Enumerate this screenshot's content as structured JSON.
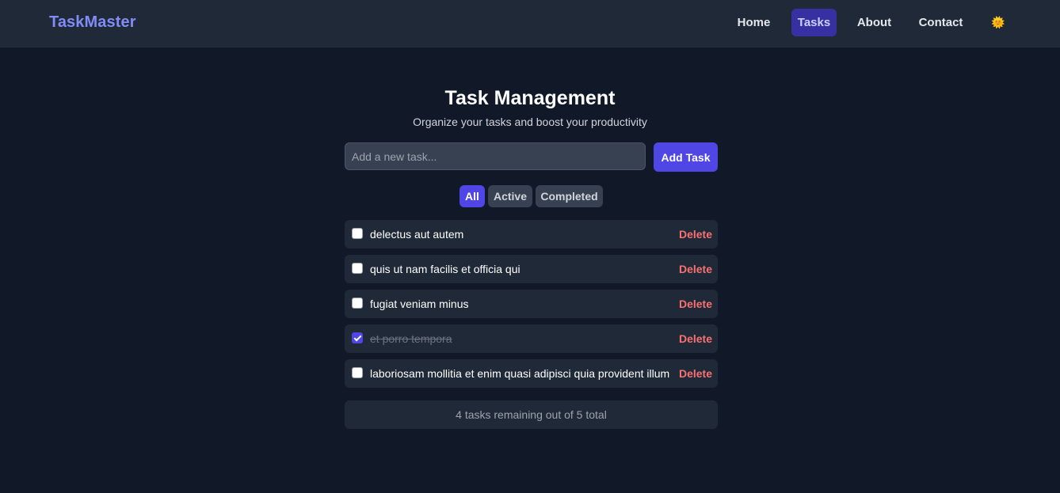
{
  "app": {
    "brand": "TaskMaster"
  },
  "nav": {
    "items": [
      {
        "label": "Home",
        "active": false
      },
      {
        "label": "Tasks",
        "active": true
      },
      {
        "label": "About",
        "active": false
      },
      {
        "label": "Contact",
        "active": false
      }
    ],
    "theme_icon": "sun-icon",
    "theme_glyph": "🌞"
  },
  "header": {
    "title": "Task Management",
    "subtitle": "Organize your tasks and boost your productivity"
  },
  "new_task": {
    "placeholder": "Add a new task...",
    "value": "",
    "button_label": "Add Task"
  },
  "filters": {
    "items": [
      {
        "label": "All",
        "active": true
      },
      {
        "label": "Active",
        "active": false
      },
      {
        "label": "Completed",
        "active": false
      }
    ]
  },
  "tasks": [
    {
      "text": "delectus aut autem",
      "completed": false,
      "delete_label": "Delete"
    },
    {
      "text": "quis ut nam facilis et officia qui",
      "completed": false,
      "delete_label": "Delete"
    },
    {
      "text": "fugiat veniam minus",
      "completed": false,
      "delete_label": "Delete"
    },
    {
      "text": "et porro tempora",
      "completed": true,
      "delete_label": "Delete"
    },
    {
      "text": "laboriosam mollitia et enim quasi adipisci quia provident illum",
      "completed": false,
      "delete_label": "Delete"
    }
  ],
  "summary": {
    "text": "4 tasks remaining out of 5 total"
  },
  "colors": {
    "background": "#111827",
    "navbar": "#1f2937",
    "brand": "#818cf8",
    "accent": "#4f46e5",
    "nav_active_bg": "#3730a3",
    "delete": "#f87171"
  }
}
